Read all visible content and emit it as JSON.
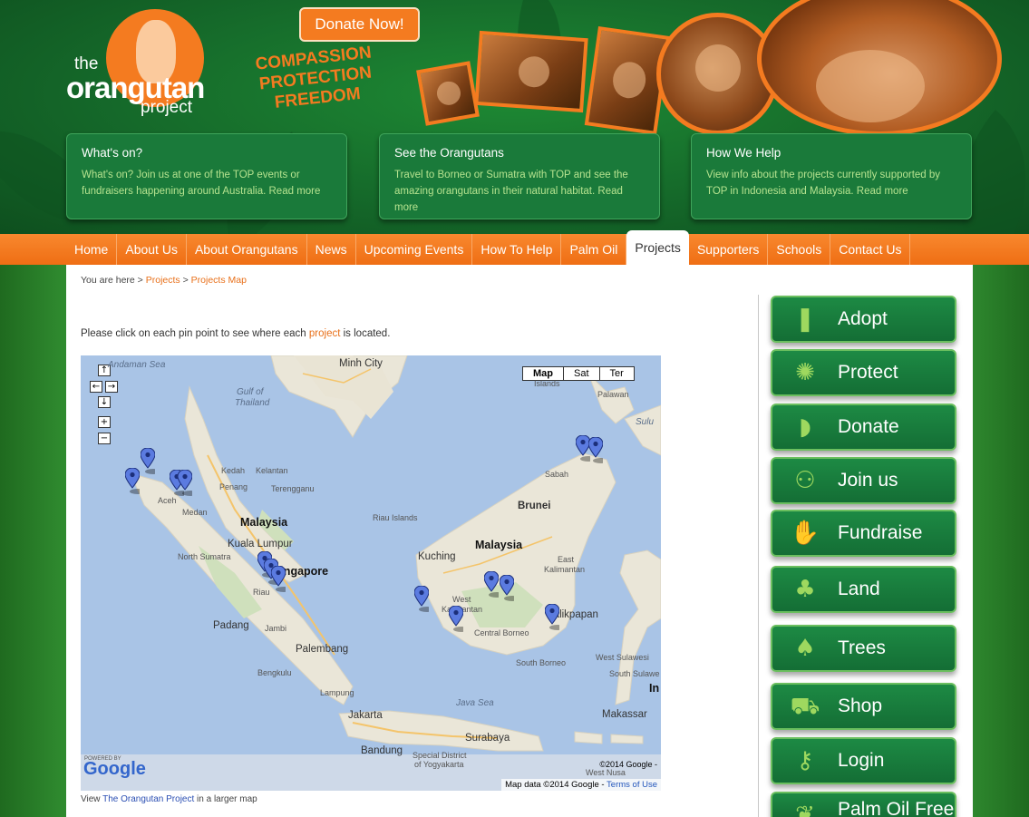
{
  "header": {
    "logo_the": "the",
    "logo_main": "orangutan",
    "logo_project": "project",
    "donate_label": "Donate Now!",
    "slogan_lines": [
      "COMPASSION",
      "PROTECTION",
      "FREEDOM"
    ]
  },
  "features": [
    {
      "title": "What's on?",
      "text": "What's on? Join us at one of the TOP events or fundraisers happening around Australia. Read more"
    },
    {
      "title": "See the Orangutans",
      "text": "Travel to Borneo or Sumatra with TOP and see the amazing orangutans in their natural habitat. Read more"
    },
    {
      "title": "How We Help",
      "text": "View info about the projects currently supported by TOP in Indonesia and Malaysia. Read more"
    }
  ],
  "nav": {
    "items": [
      "Home",
      "About Us",
      "About Orangutans",
      "News",
      "Upcoming Events",
      "How To Help",
      "Palm Oil",
      "Projects",
      "Supporters",
      "Schools",
      "Contact Us"
    ],
    "active": "Projects"
  },
  "breadcrumb": {
    "prefix": "You are here",
    "sep": ">",
    "items": [
      "Projects",
      "Projects Map"
    ]
  },
  "intro": {
    "before": "Please click on each pin point to see where each ",
    "link": "project",
    "after": " is located."
  },
  "map": {
    "types": [
      "Map",
      "Sat",
      "Ter"
    ],
    "controls": [
      "↑",
      "←",
      "→",
      "↓",
      "+",
      "−"
    ],
    "labels": {
      "andaman": "Andaman Sea",
      "minh_chi": "Minh City",
      "gulf": "Gulf of",
      "thailand": "Thailand",
      "islands": "Islands",
      "palawan": "Palawan",
      "sulu": "Sulu",
      "kedah": "Kedah",
      "kelantan": "Kelantan",
      "penang": "Penang",
      "terengganu": "Terengganu",
      "sabah": "Sabah",
      "aceh": "Aceh",
      "medan": "Medan",
      "malaysia_w": "Malaysia",
      "riau_islands": "Riau Islands",
      "brunei": "Brunei",
      "kuala_lumpur": "Kuala Lumpur",
      "north_sumatra": "North Sumatra",
      "malaysia_e": "Malaysia",
      "singapore": "Singapore",
      "kuching": "Kuching",
      "east": "East",
      "kalimantan_e": "Kalimantan",
      "riau": "Riau",
      "west": "West",
      "kalimantan_w": "Kalimantan",
      "balikpapan": "Balikpapan",
      "padang": "Padang",
      "jambi": "Jambi",
      "central_borneo": "Central Borneo",
      "palembang": "Palembang",
      "west_sulawesi": "West Sulawesi",
      "south_borneo": "South Borneo",
      "south_sulawe": "South Sulawe",
      "bengkulu": "Bengkulu",
      "in_partial": "In",
      "lampung": "Lampung",
      "java_sea": "Java Sea",
      "makassar": "Makassar",
      "jakarta": "Jakarta",
      "surabaya": "Surabaya",
      "bandung": "Bandung",
      "special_district": "Special District",
      "yogyakarta": "of Yogyakarta",
      "west_nusa": "West Nusa"
    },
    "powered_by": "POWERED BY",
    "google": "Google",
    "copyright": "©2014 Google -",
    "map_data": "Map data ©2014 Google - ",
    "terms": "Terms of Use"
  },
  "caption": {
    "before": "View ",
    "link": "The Orangutan Project",
    "after": " in a larger map"
  },
  "side_buttons": [
    {
      "label": "Adopt",
      "icon": "bottle-icon",
      "glyph": "❚"
    },
    {
      "label": "Protect",
      "icon": "fern-icon",
      "glyph": "✺"
    },
    {
      "label": "Donate",
      "icon": "banana-icon",
      "glyph": "◗"
    },
    {
      "label": "Join us",
      "icon": "people-icon",
      "glyph": "⚇"
    },
    {
      "label": "Fundraise",
      "icon": "hand-icon",
      "glyph": "✋"
    },
    {
      "label": "Land",
      "icon": "sapling-icon",
      "glyph": "♣"
    },
    {
      "label": "Trees",
      "icon": "tree-icon",
      "glyph": "♠"
    },
    {
      "label": "Shop",
      "icon": "cart-icon",
      "glyph": "⛟"
    },
    {
      "label": "Login",
      "icon": "key-icon",
      "glyph": "⚷"
    },
    {
      "label": "Palm Oil Free",
      "icon": "leaf-icon",
      "glyph": "❦"
    }
  ],
  "colors": {
    "brand_orange": "#f47b20",
    "brand_green": "#15692a",
    "button_green": "#1d8a44",
    "accent_green": "#9ed85f"
  }
}
